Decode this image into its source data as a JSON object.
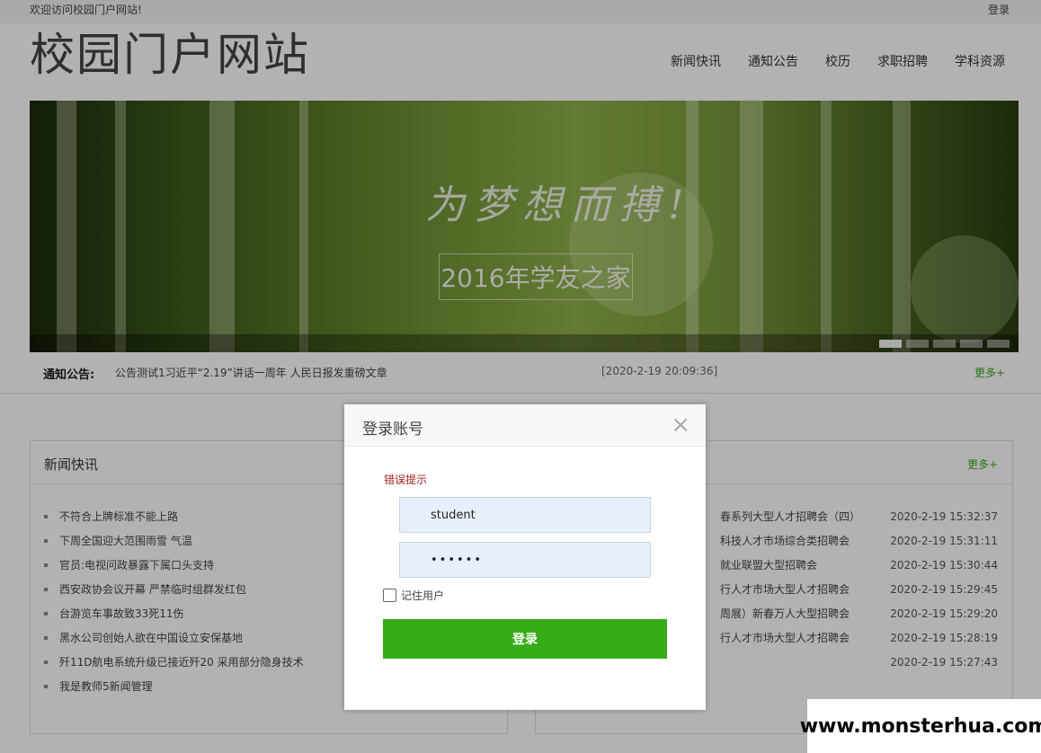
{
  "top_bar": {
    "welcome": "欢迎访问校园门户网站!",
    "login": "登录"
  },
  "header": {
    "logo": "校园门户网站",
    "nav": [
      "新闻快讯",
      "通知公告",
      "校历",
      "求职招聘",
      "学科资源"
    ]
  },
  "banner": {
    "slogan": "为梦想而搏!",
    "subtitle": "2016年学友之家",
    "slides": 5,
    "active_slide": 1
  },
  "notice": {
    "label": "通知公告:",
    "text": "公告测试1习近平“2.19”讲话一周年 人民日报发重磅文章",
    "time": "[2020-2-19 20:09:36]",
    "more": "更多+"
  },
  "news_panel": {
    "title": "新闻快讯",
    "items": [
      "不符合上牌标准不能上路",
      "下周全国迎大范围雨雪 气温",
      "官员:电视问政暴露下属口头支持",
      "西安政协会议开幕 严禁临时组群发红包",
      "台游览车事故致33死11伤",
      "黑水公司创始人欲在中国设立安保基地",
      "歼11D航电系统升级已接近歼20 采用部分隐身技术",
      "我是教师5新闻管理"
    ]
  },
  "jobs_panel": {
    "more": "更多+",
    "items": [
      {
        "title": "春系列大型人才招聘会（四）",
        "date": "2020-2-19 15:32:37"
      },
      {
        "title": "科技人才市场综合类招聘会",
        "date": "2020-2-19 15:31:11"
      },
      {
        "title": "就业联盟大型招聘会",
        "date": "2020-2-19 15:30:44"
      },
      {
        "title": "行人才市场大型人才招聘会",
        "date": "2020-2-19 15:29:45"
      },
      {
        "title": "周展）新春万人大型招聘会",
        "date": "2020-2-19 15:29:20"
      },
      {
        "title": "行人才市场大型人才招聘会",
        "date": "2020-2-19 15:28:19"
      },
      {
        "title": "",
        "date": "2020-2-19 15:27:43"
      }
    ]
  },
  "login_modal": {
    "title": "登录账号",
    "close": "×",
    "error": "错误提示",
    "username": "student",
    "password": "••••••",
    "remember": "记住用户",
    "submit": "登录"
  },
  "watermark": "www.monsterhua.com"
}
